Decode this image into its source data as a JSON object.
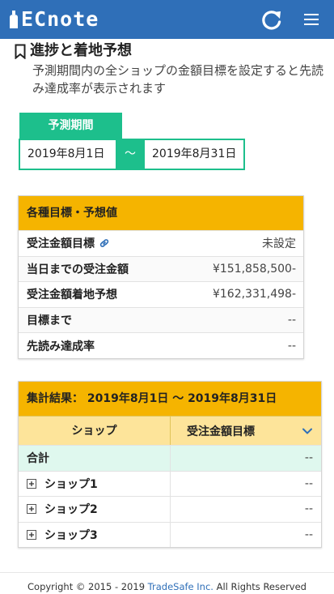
{
  "header": {
    "logo_text": "ECnote",
    "brand_color": "#2f6fb8",
    "icons": [
      "reload-icon",
      "hamburger-menu-icon"
    ]
  },
  "page": {
    "title": "進捗と着地予想",
    "description": "予測期間内の全ショップの金額目標を設定すると先読み達成率が表示されます"
  },
  "period": {
    "label": "予測期間",
    "start": "2019年8月1日",
    "separator": "〜",
    "end": "2019年8月31日",
    "accent_color": "#1dbf8c"
  },
  "targets": {
    "heading": "各種目標・予想値",
    "rows": [
      {
        "label": "受注金額目標",
        "value": "未設定"
      },
      {
        "label": "当日までの受注金額",
        "value": "¥151,858,500-"
      },
      {
        "label": "受注金額着地予想",
        "value": "¥162,331,498-"
      },
      {
        "label": "目標まで",
        "value": "--"
      },
      {
        "label": "先読み達成率",
        "value": "--"
      }
    ]
  },
  "results": {
    "heading": "集計結果：  2019年8月1日 〜 2019年8月31日",
    "col_shop": "ショップ",
    "col_target": "受注金額目標",
    "total": {
      "name": "合計",
      "value": "--"
    },
    "shops": [
      {
        "name": "ショップ1",
        "value": "--"
      },
      {
        "name": "ショップ2",
        "value": "--"
      },
      {
        "name": "ショップ3",
        "value": "--"
      }
    ],
    "header_color": "#f5b400"
  },
  "footer": {
    "copyright_prefix": "Copyright © 2015 - 2019 ",
    "company": "TradeSafe Inc.",
    "copyright_suffix": " All Rights Reserved"
  }
}
